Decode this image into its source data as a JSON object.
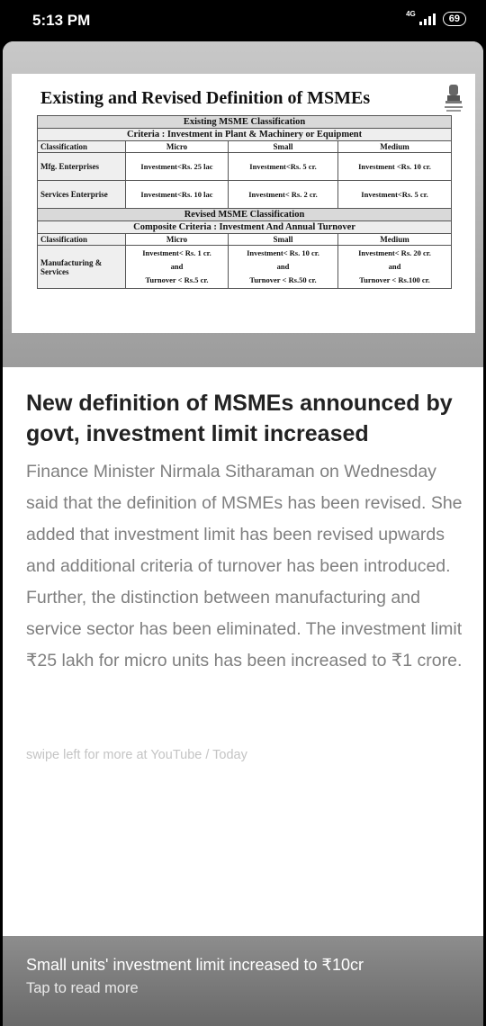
{
  "status_bar": {
    "time": "5:13 PM",
    "network": "4G",
    "battery": "69"
  },
  "article_image": {
    "title": "Existing and Revised Definition of MSMEs",
    "existing_heading": "Existing MSME Classification",
    "existing_criteria": "Criteria  :  Investment in Plant & Machinery or Equipment",
    "columns": [
      "Classification",
      "Micro",
      "Small",
      "Medium"
    ],
    "existing_rows": [
      {
        "label": "Mfg. Enterprises",
        "micro": "Investment<Rs. 25 lac",
        "small": "Investment<Rs. 5 cr.",
        "medium": "Investment <Rs. 10 cr."
      },
      {
        "label": "Services Enterprise",
        "micro": "Investment<Rs. 10 lac",
        "small": "Investment< Rs. 2 cr.",
        "medium": "Investment<Rs. 5 cr."
      }
    ],
    "revised_heading": "Revised MSME Classification",
    "revised_criteria": "Composite Criteria  :  Investment And Annual Turnover",
    "revised_rows": [
      {
        "label": "Manufacturing & Services",
        "micro": [
          "Investment< Rs. 1 cr.",
          "and",
          "Turnover < Rs.5 cr."
        ],
        "small": [
          "Investment< Rs. 10 cr.",
          "and",
          "Turnover < Rs.50 cr."
        ],
        "medium": [
          "Investment< Rs. 20 cr.",
          "and",
          "Turnover < Rs.100 cr."
        ]
      }
    ]
  },
  "article": {
    "headline": "New definition of MSMEs announced by govt, investment limit increased",
    "body": "Finance Minister Nirmala Sitharaman on Wednesday said that the definition of MSMEs has been revised. She added that investment limit has been revised upwards and additional criteria of turnover has been introduced. Further, the distinction between manufacturing and service sector has been eliminated. The investment limit ₹25 lakh for micro units has been increased to ₹1 crore.",
    "source": "swipe left for more at YouTube / Today"
  },
  "footer": {
    "title": "Small units' investment limit increased to ₹10cr",
    "subtitle": "Tap to read more"
  }
}
